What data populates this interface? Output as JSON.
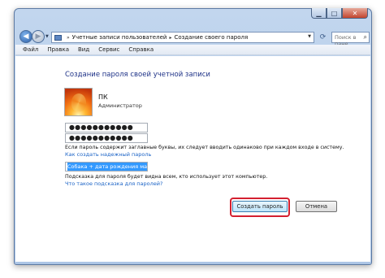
{
  "window": {
    "caption_buttons": {
      "minimize": "▁",
      "maximize": "□",
      "close": "✕"
    }
  },
  "nav": {
    "back_icon": "◀",
    "forward_icon": "▶",
    "breadcrumb": [
      "Учетные записи пользователей",
      "Создание своего пароля"
    ],
    "breadcrumb_separator": "▸",
    "search_placeholder": "Поиск в пане..."
  },
  "menu": {
    "items": [
      "Файл",
      "Правка",
      "Вид",
      "Сервис",
      "Справка"
    ]
  },
  "main": {
    "heading": "Создание пароля своей учетной записи",
    "user": {
      "name": "ПК",
      "role": "Администратор"
    },
    "password_mask": "●●●●●●●●●●●",
    "confirm_mask": "●●●●●●●●●●●",
    "case_note": "Если пароль содержит заглавные буквы, их следует вводить одинаково при каждом входе в систему.",
    "strong_password_link": "Как создать надежный пароль",
    "hint_value": "Собака + дата рождения матери",
    "hint_note": "Подсказка для пароля будет видна всем, кто использует этот компьютер.",
    "hint_link": "Что такое подсказка для паролей?",
    "create_button": "Создать пароль",
    "cancel_button": "Отмена"
  },
  "colors": {
    "heading": "#1e3287",
    "link": "#1b63c6",
    "highlight_ring": "#d42030",
    "selection": "#3399ff"
  }
}
